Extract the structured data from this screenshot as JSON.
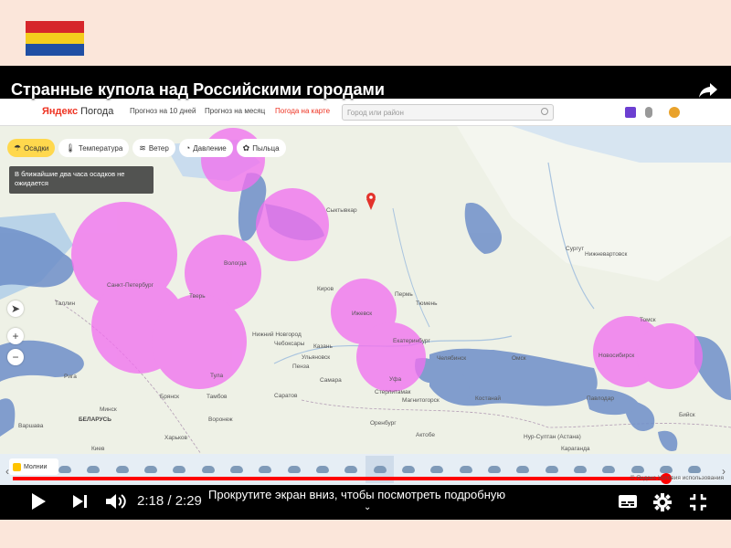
{
  "flag": {
    "colors": [
      "#d6262b",
      "#f4cd1d",
      "#1f4fa4"
    ]
  },
  "video": {
    "title": "Странные купола над Российскими городами",
    "current_time": "2:18",
    "duration": "2:29",
    "time_display": "2:18 / 2:29",
    "caption": "Прокрутите экран вниз, чтобы посмотреть подробную",
    "progress_fraction": 0.926,
    "buffered_fraction": 0.95
  },
  "site": {
    "logo_brand": "Яндекс",
    "logo_product": "Погода",
    "nav": [
      "Прогноз на 10 дней",
      "Прогноз на месяц",
      "Погода на карте"
    ],
    "active_nav": "Погода на карте",
    "search_placeholder": "Город или район"
  },
  "map": {
    "layers": [
      {
        "label": "Осадки",
        "icon": "umbrella-icon",
        "active": true
      },
      {
        "label": "Температура",
        "icon": "thermometer-icon",
        "active": false
      },
      {
        "label": "Ветер",
        "icon": "wind-icon",
        "active": false
      },
      {
        "label": "Давление",
        "icon": "gauge-icon",
        "active": false
      },
      {
        "label": "Пыльца",
        "icon": "pollen-icon",
        "active": false
      }
    ],
    "precip_note": "В ближайшие два часа осадков не ожидается",
    "lightning_label": "Молнии",
    "copyright": "© Яндекс Условия использования",
    "labels": {
      "syktyvkar": "Сыктывкар",
      "surgut": "Сургут",
      "nizhnevartovsk": "Нижневартовск",
      "saint_petersburg": "Санкт-Петербург",
      "kirov": "Киров",
      "izhevsk": "Ижевск",
      "perm": "Пермь",
      "nizhny_novgorod": "Нижний Новгород",
      "cheboksary": "Чебоксары",
      "kazan": "Казань",
      "tyumen": "Тюмень",
      "ekaterinburg": "Екатеринбург",
      "chelyabinsk": "Челябинск",
      "omsk": "Омск",
      "novosibirsk": "Новосибирск",
      "ufa": "Уфа",
      "sterlitamak": "Стерлитамак",
      "magnitogorsk": "Магнитогорск",
      "samara": "Самара",
      "saratov": "Саратов",
      "penza": "Пенза",
      "voronezh": "Воронеж",
      "belarus": "БЕЛАРУСЬ",
      "warsaw": "Варшава",
      "orenburg": "Оренбург",
      "nur_sultan": "Нур-Султан (Астана)",
      "karaganda": "Караганда",
      "tula": "Тула",
      "bryansk": "Брянск",
      "tambov": "Тамбов",
      "tver": "Тверь",
      "vologda": "Вологда",
      "kharkiv": "Харьков",
      "minsk": "Минск",
      "pavlodar": "Павлодар",
      "tomsk": "Томск",
      "kostanay": "Костанай",
      "riga": "Рига",
      "tallinn": "Таллин",
      "kyiv": "Киев",
      "ulyanovsk": "Ульяновск",
      "biysk": "Бийск",
      "aktobe": "Актобе"
    }
  },
  "timeline": {
    "cell_count": 24,
    "current_index": 12
  }
}
